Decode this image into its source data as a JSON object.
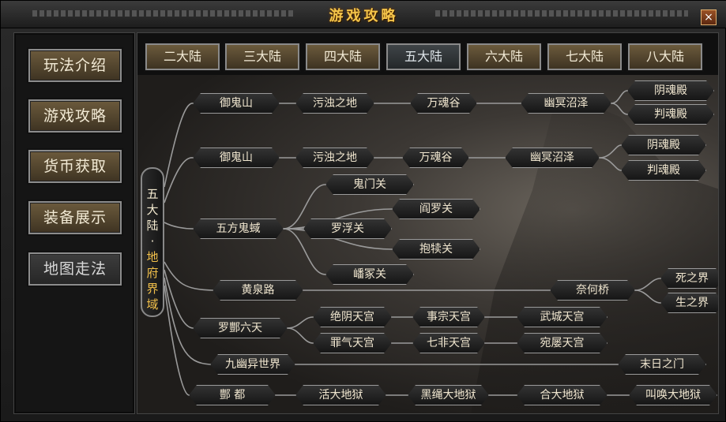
{
  "window": {
    "title": "游戏攻略",
    "close_label": "×"
  },
  "sidebar": {
    "items": [
      {
        "label": "玩法介绍",
        "active": true
      },
      {
        "label": "游戏攻略",
        "active": true
      },
      {
        "label": "货币获取",
        "active": true
      },
      {
        "label": "装备展示",
        "active": true
      },
      {
        "label": "地图走法",
        "active": false
      }
    ]
  },
  "tabs": [
    {
      "label": "二大陆"
    },
    {
      "label": "三大陆"
    },
    {
      "label": "四大陆"
    },
    {
      "label": "五大陆",
      "selected": true
    },
    {
      "label": "六大陆"
    },
    {
      "label": "七大陆"
    },
    {
      "label": "八大陆"
    }
  ],
  "region_label": {
    "part1": [
      "五",
      "大",
      "陆",
      "·"
    ],
    "part2": [
      "地",
      "府",
      "界",
      "域"
    ]
  },
  "map_tree": {
    "nodes": [
      {
        "id": "n1",
        "label": "御鬼山"
      },
      {
        "id": "n2",
        "label": "污浊之地"
      },
      {
        "id": "n3",
        "label": "万魂谷"
      },
      {
        "id": "n4",
        "label": "幽冥沼泽"
      },
      {
        "id": "n5",
        "label": "阴魂殿"
      },
      {
        "id": "n6",
        "label": "判魂殿"
      },
      {
        "id": "m1",
        "label": "御鬼山"
      },
      {
        "id": "m2",
        "label": "污浊之地"
      },
      {
        "id": "m3",
        "label": "万魂谷"
      },
      {
        "id": "m4",
        "label": "幽冥沼泽"
      },
      {
        "id": "m5",
        "label": "阴魂殿"
      },
      {
        "id": "m6",
        "label": "判魂殿"
      },
      {
        "id": "g0",
        "label": "五方鬼蜮"
      },
      {
        "id": "g1",
        "label": "鬼门关"
      },
      {
        "id": "g2",
        "label": "阎罗关"
      },
      {
        "id": "g3",
        "label": "罗浮关"
      },
      {
        "id": "g4",
        "label": "抱犊关"
      },
      {
        "id": "g5",
        "label": "嶓冢关"
      },
      {
        "id": "h0",
        "label": "黄泉路"
      },
      {
        "id": "h1",
        "label": "奈何桥"
      },
      {
        "id": "h2",
        "label": "死之界"
      },
      {
        "id": "h3",
        "label": "生之界"
      },
      {
        "id": "f0",
        "label": "罗酆六天"
      },
      {
        "id": "f1",
        "label": "绝阴天宫"
      },
      {
        "id": "f2",
        "label": "事宗天宫"
      },
      {
        "id": "f3",
        "label": "武城天宫"
      },
      {
        "id": "f4",
        "label": "罪气天宫"
      },
      {
        "id": "f5",
        "label": "七非天宫"
      },
      {
        "id": "f6",
        "label": "宛屡天宫"
      },
      {
        "id": "j0",
        "label": "九幽异世界"
      },
      {
        "id": "j1",
        "label": "末日之门"
      },
      {
        "id": "d0",
        "label": "酆 都"
      },
      {
        "id": "d1",
        "label": "活大地狱"
      },
      {
        "id": "d2",
        "label": "黑绳大地狱"
      },
      {
        "id": "d3",
        "label": "合大地狱"
      },
      {
        "id": "d4",
        "label": "叫唤大地狱"
      }
    ]
  }
}
